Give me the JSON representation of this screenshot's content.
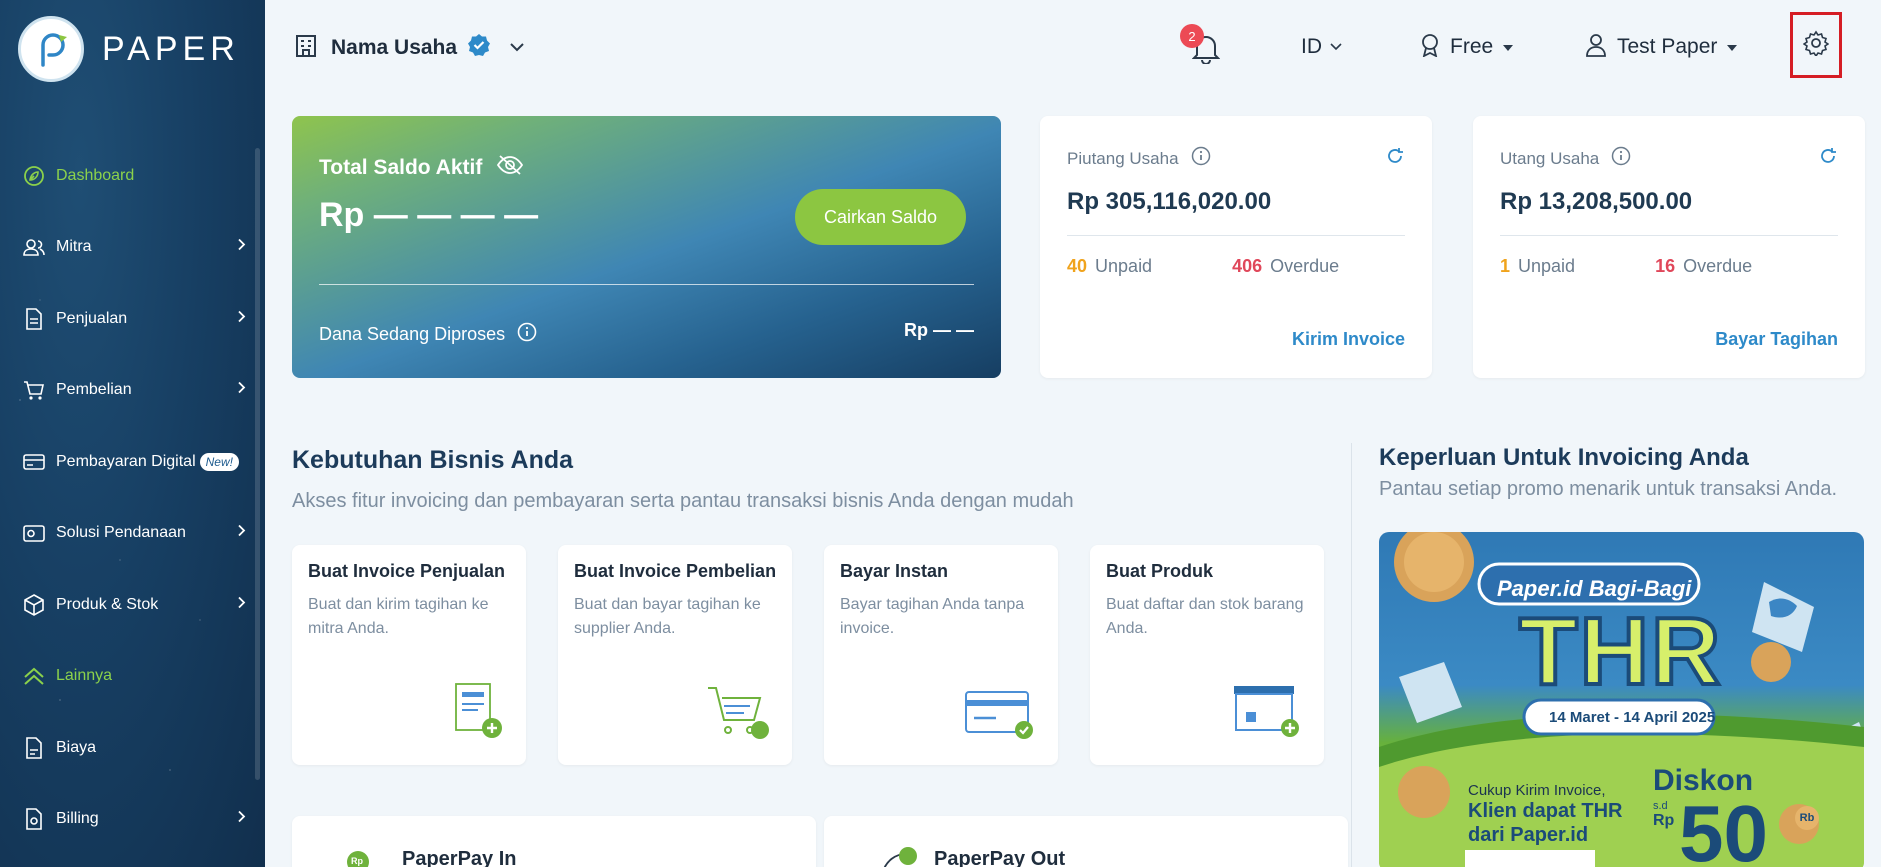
{
  "app": {
    "brand": "PAPER"
  },
  "colors": {
    "accent": "#8cc641",
    "sidebar_bg": "#173f63",
    "link": "#2e8ac9",
    "unpaid": "#f0a31c",
    "overdue": "#e0475a",
    "highlight_box": "#d51d24"
  },
  "sidebar": {
    "items": [
      {
        "label": "Dashboard",
        "icon": "leaf-icon",
        "active": true
      },
      {
        "label": "Mitra",
        "icon": "users-icon"
      },
      {
        "label": "Penjualan",
        "icon": "document-icon"
      },
      {
        "label": "Pembelian",
        "icon": "cart-icon"
      },
      {
        "label": "Pembayaran Digital",
        "icon": "card-icon",
        "badge": "New!"
      },
      {
        "label": "Solusi Pendanaan",
        "icon": "wallet-icon"
      },
      {
        "label": "Produk & Stok",
        "icon": "box-icon"
      },
      {
        "label": "Lainnya",
        "icon": "chevrons-up-icon",
        "active": true
      },
      {
        "label": "Biaya",
        "icon": "receipt-icon"
      },
      {
        "label": "Billing",
        "icon": "bill-icon"
      }
    ]
  },
  "header": {
    "business_name": "Nama Usaha",
    "notif_count": "2",
    "language": "ID",
    "plan": "Free",
    "user": "Test Paper"
  },
  "saldo": {
    "title": "Total Saldo Aktif",
    "amount": "Rp — — — —",
    "button": "Cairkan Saldo",
    "processing_label": "Dana Sedang Diproses",
    "processing_amount": "Rp — —"
  },
  "piutang": {
    "label": "Piutang Usaha",
    "value": "Rp 305,116,020.00",
    "unpaid_count": "40",
    "unpaid_label": "Unpaid",
    "overdue_count": "406",
    "overdue_label": "Overdue",
    "link": "Kirim Invoice"
  },
  "utang": {
    "label": "Utang Usaha",
    "value": "Rp 13,208,500.00",
    "unpaid_count": "1",
    "unpaid_label": "Unpaid",
    "overdue_count": "16",
    "overdue_label": "Overdue",
    "link": "Bayar Tagihan"
  },
  "needs": {
    "title": "Kebutuhan Bisnis Anda",
    "subtitle": "Akses fitur invoicing dan pembayaran serta pantau transaksi bisnis Anda dengan mudah",
    "features": [
      {
        "title": "Buat Invoice Penjualan",
        "desc": "Buat dan kirim tagihan ke mitra Anda."
      },
      {
        "title": "Buat Invoice Pembelian",
        "desc": "Buat dan bayar tagihan ke supplier Anda."
      },
      {
        "title": "Bayar Instan",
        "desc": "Bayar tagihan Anda tanpa invoice."
      },
      {
        "title": "Buat Produk",
        "desc": "Buat daftar dan stok barang Anda."
      }
    ],
    "pay_in": "PaperPay In",
    "pay_out": "PaperPay Out",
    "rp_badge": "Rp"
  },
  "promo": {
    "title": "Keperluan Untuk Invoicing Anda",
    "subtitle": "Pantau setiap promo menarik untuk transaksi Anda.",
    "banner_heading": "Paper.id Bagi-Bagi",
    "banner_big": "THR",
    "banner_dates": "14 Maret - 14 April 2025",
    "banner_line1": "Cukup Kirim Invoice,",
    "banner_line2": "Klien dapat THR",
    "banner_line3": "dari Paper.id",
    "banner_discount": "Diskon",
    "banner_sd": "s.d",
    "banner_rp": "Rp",
    "banner_value": "50",
    "banner_suffix": "Rb"
  }
}
